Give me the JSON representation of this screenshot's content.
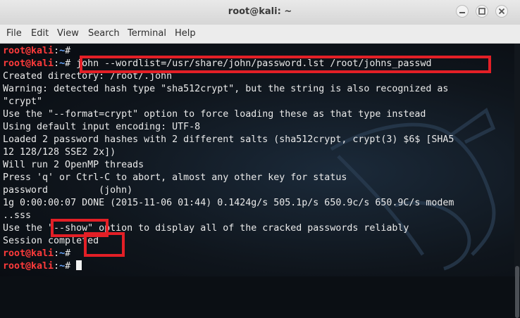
{
  "window": {
    "title": "root@kali: ~"
  },
  "menu": [
    "File",
    "Edit",
    "View",
    "Search",
    "Terminal",
    "Help"
  ],
  "prompt": {
    "user": "root@kali",
    "sep": ":",
    "path": "~",
    "symbol": "# "
  },
  "terminal": {
    "command": "john --wordlist=/usr/share/john/password.lst /root/johns_passwd",
    "out": [
      "Created directory: /root/.john",
      "Warning: detected hash type \"sha512crypt\", but the string is also recognized as",
      "\"crypt\"",
      "Use the \"--format=crypt\" option to force loading these as that type instead",
      "Using default input encoding: UTF-8",
      "Loaded 2 password hashes with 2 different salts (sha512crypt, crypt(3) $6$ [SHA5",
      "12 128/128 SSE2 2x])",
      "Will run 2 OpenMP threads",
      "Press 'q' or Ctrl-C to abort, almost any other key for status",
      "password         (john)",
      "1g 0:00:00:07 DONE (2015-11-06 01:44) 0.1424g/s 505.1p/s 650.9c/s 650.9C/s modem",
      "..sss",
      "Use the \"--show\" option to display all of the cracked passwords reliably",
      "Session completed"
    ]
  },
  "colors": {
    "user": "#ff3b3b",
    "path": "#6aa7ff",
    "highlight": "#e31f26"
  },
  "icons": {
    "min": "minimize-icon",
    "max": "maximize-icon",
    "close": "close-icon"
  }
}
